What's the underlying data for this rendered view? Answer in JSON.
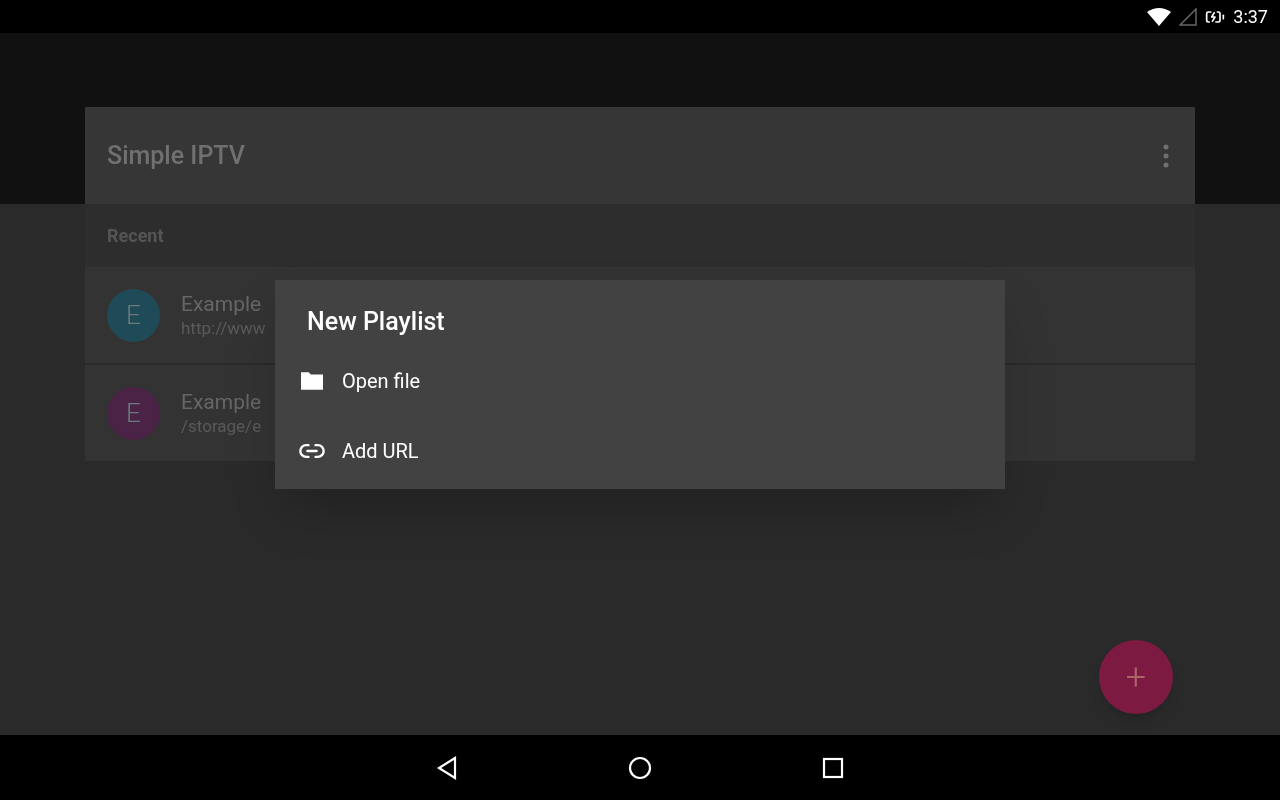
{
  "status_bar": {
    "time": "3:37"
  },
  "app_bar": {
    "title": "Simple IPTV"
  },
  "section": {
    "title": "Recent"
  },
  "playlists": [
    {
      "initial": "E",
      "name": "Example",
      "subtitle": "http://www",
      "color": "#1f4a57"
    },
    {
      "initial": "E",
      "name": "Example",
      "subtitle": "/storage/e",
      "color": "#4a2346"
    }
  ],
  "dialog": {
    "title": "New Playlist",
    "items": [
      {
        "kind": "file",
        "label": "Open file"
      },
      {
        "kind": "url",
        "label": "Add URL"
      }
    ]
  },
  "fab": {
    "label": "+"
  }
}
